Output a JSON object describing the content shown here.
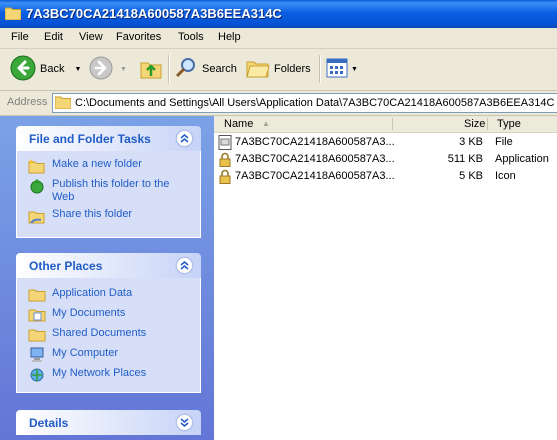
{
  "window": {
    "title": "7A3BC70CA21418A600587A3B6EEA314C"
  },
  "menu": [
    "File",
    "Edit",
    "View",
    "Favorites",
    "Tools",
    "Help"
  ],
  "toolbar": {
    "back_label": "Back",
    "search_label": "Search",
    "folders_label": "Folders"
  },
  "address": {
    "label": "Address",
    "value": "C:\\Documents and Settings\\All Users\\Application Data\\7A3BC70CA21418A600587A3B6EEA314C"
  },
  "tasks": {
    "file_folder": {
      "title": "File and Folder Tasks",
      "items": [
        "Make a new folder",
        "Publish this folder to the Web",
        "Share this folder"
      ]
    },
    "other_places": {
      "title": "Other Places",
      "items": [
        "Application Data",
        "My Documents",
        "Shared Documents",
        "My Computer",
        "My Network Places"
      ]
    },
    "details": {
      "title": "Details"
    }
  },
  "filelist": {
    "columns": {
      "name": "Name",
      "size": "Size",
      "type": "Type"
    },
    "rows": [
      {
        "name": "7A3BC70CA21418A600587A3...",
        "size": "3 KB",
        "type": "File",
        "icon": "generic-file-icon"
      },
      {
        "name": "7A3BC70CA21418A600587A3...",
        "size": "511 KB",
        "type": "Application",
        "icon": "locked-file-icon"
      },
      {
        "name": "7A3BC70CA21418A600587A3...",
        "size": "5 KB",
        "type": "Icon",
        "icon": "locked-file-icon"
      }
    ]
  }
}
